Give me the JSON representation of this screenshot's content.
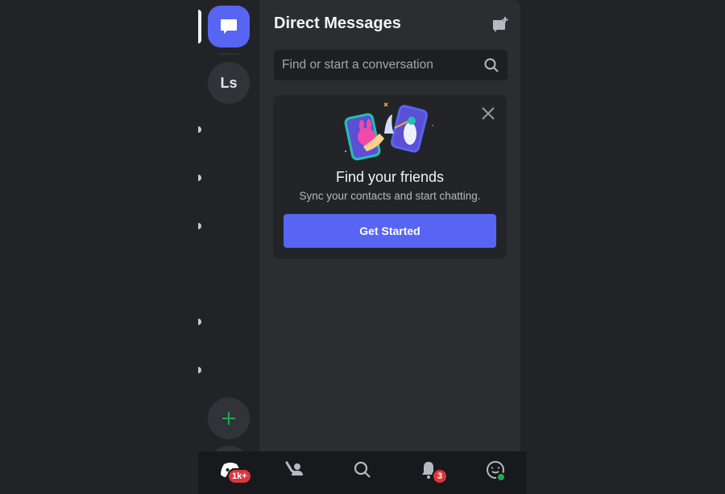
{
  "rail": {
    "dm_label": "Direct Messages",
    "servers": [
      {
        "initials": "Ls"
      }
    ],
    "unread_dots": 5,
    "add_server_label": "+"
  },
  "dm_panel": {
    "title": "Direct Messages",
    "new_dm_icon": "new-message-icon",
    "search": {
      "placeholder": "Find or start a conversation",
      "value": ""
    }
  },
  "find_friends_card": {
    "title": "Find your friends",
    "subtitle": "Sync your contacts and start chatting.",
    "button_label": "Get Started"
  },
  "bottom_nav": {
    "items": [
      {
        "name": "home",
        "icon": "discord-logo-icon",
        "badge": "1k+"
      },
      {
        "name": "friends",
        "icon": "friends-wave-icon"
      },
      {
        "name": "search",
        "icon": "search-icon"
      },
      {
        "name": "notifications",
        "icon": "bell-icon",
        "badge": "3"
      },
      {
        "name": "you",
        "icon": "profile-icon",
        "status": "online"
      }
    ]
  },
  "colors": {
    "accent": "#5865f2",
    "badge": "#da373c",
    "online": "#23a55a",
    "add_green": "#23a55a"
  }
}
